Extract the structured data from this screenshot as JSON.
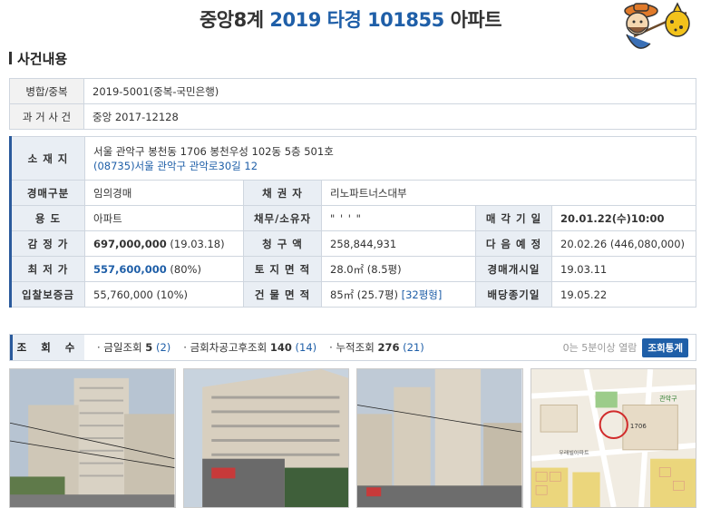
{
  "title": {
    "court": "중앙8계",
    "case_no": "2019 타경 101855",
    "kind": "아파트"
  },
  "section_title": "사건내용",
  "rows": {
    "merged_label": "병합/중복",
    "merged_value": "2019-5001(중복-국민은행)",
    "past_label": "과 거 사 건",
    "past_value": "중앙 2017-12128",
    "location_label": "소 재 지",
    "location_line1": "서울 관악구 봉천동 1706 봉천우성 102동 5층 501호",
    "location_line2": "(08735)서울 관악구  관악로30길  12",
    "auction_type_label": "경매구분",
    "auction_type_value": "임의경매",
    "creditor_label": "채 권 자",
    "creditor_value": "리노파트너스대부",
    "use_label": "용 도",
    "use_value": "아파트",
    "debtor_label": "채무/소유자",
    "debtor_value": "\" ' ' \"",
    "sale_date_label": "매 각 기 일",
    "sale_date_value": "20.01.22(수)10:00",
    "appraisal_label": "감 정 가",
    "appraisal_amount": "697,000,000",
    "appraisal_date": "(19.03.18)",
    "claim_label": "청 구 액",
    "claim_value": "258,844,931",
    "next_label": "다 음 예 정",
    "next_value": "20.02.26 (446,080,000)",
    "min_label": "최 저 가",
    "min_amount": "557,600,000",
    "min_rate": "(80%)",
    "land_label": "토 지 면 적",
    "land_value": "28.0㎡ (8.5평)",
    "start_label": "경매개시일",
    "start_value": "19.03.11",
    "deposit_label": "입찰보증금",
    "deposit_value": "55,760,000 (10%)",
    "building_label": "건 물 면 적",
    "building_value": "85㎡ (25.7평)",
    "building_link": "[32평형]",
    "dividend_label": "배당종기일",
    "dividend_value": "19.05.22"
  },
  "views": {
    "label": "조 회 수",
    "today_label": "· 금일조회",
    "today_n": "5",
    "today_p": "(2)",
    "after_label": "· 금회차공고후조회",
    "after_n": "140",
    "after_p": "(14)",
    "total_label": "· 누적조회",
    "total_n": "276",
    "total_p": "(21)",
    "note": "0는 5분이상 열람",
    "button": "조회통계"
  },
  "map_labels": {
    "station": "우래빌아파트",
    "dong": "1706",
    "district": "관악구"
  },
  "colors": {
    "accent": "#1f5fa8",
    "label_bg": "#e9eef4"
  }
}
